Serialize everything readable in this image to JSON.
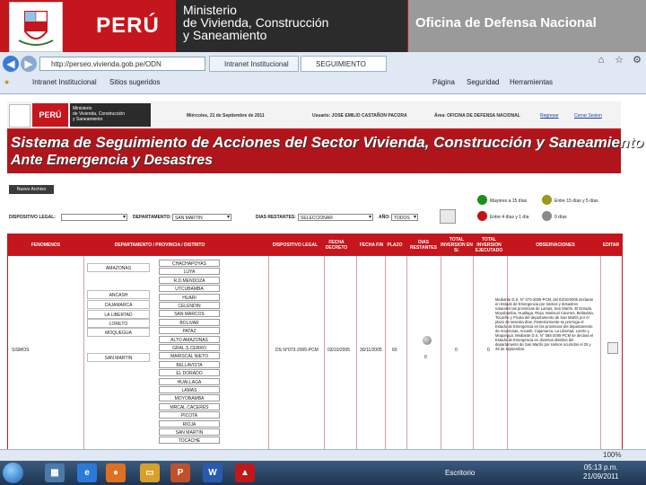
{
  "banner": {
    "country": "PERÚ",
    "ministry_lines": [
      "Ministerio",
      "de Vivienda, Construcción",
      "y Saneamiento"
    ],
    "office": "Oficina de Defensa Nacional"
  },
  "browser": {
    "address": "http://perseo.vivienda.gob.pe/ODN",
    "tabs": [
      "Intranet Institucional",
      "SEGUIMIENTO"
    ],
    "favorites": [
      "Intranet Institucional",
      "Sitios sugeridos"
    ],
    "menu": [
      "Página",
      "Seguridad",
      "Herramientas"
    ],
    "zoom": "100%"
  },
  "site": {
    "country": "PERÚ",
    "ministry_lines": [
      "Ministerio",
      "de Vivienda, Construcción",
      "y Saneamiento"
    ],
    "date": "Miércoles, 21 de Septiembre de 2011",
    "user": "Usuario: JOSE EMILIO CASTAÑON PACORA",
    "area": "Área: OFICINA DE DEFENSA NACIONAL",
    "link_back": "Regresar",
    "link_logout": "Cerrar Sesion",
    "title_line1": "Sistema de Seguimiento de Acciones del Sector Vivienda, Construcción y Saneamiento",
    "title_line2": "Ante Emergencia y Desastres",
    "new_button": "Nuevo Archivo",
    "legend": [
      {
        "label": "Mayores a 15 días",
        "color": "#1a8f1a"
      },
      {
        "label": "Entre 15 días y 5 días",
        "color": "#9a9a1a"
      },
      {
        "label": "Entre 4 días y 1 día",
        "color": "#c41111"
      },
      {
        "label": "0 días",
        "color": "#8a8a8a"
      }
    ],
    "filters": {
      "dispositivo_label": "DISPOSITIVO LEGAL:",
      "departamento_label": "DEPARTAMENTO:",
      "departamento_value": "SAN MARTIN",
      "dias_label": "DIAS RESTANTES:",
      "dias_value": "SELECCIONAR",
      "anio_label": "AÑO:",
      "anio_value": "TODOS"
    }
  },
  "table": {
    "headers": [
      "FENOMENOS",
      "DEPARTAMENTO / PROVINCIA / DISTRITO",
      "DISPOSITIVO LEGAL",
      "FECHA DECRETO",
      "FECHA FIN",
      "PLAZO",
      "DIAS RESTANTES",
      "TOTAL INVERSION EN S/.",
      "TOTAL INVERSION EJECUTADO",
      "OBSERVACIONES",
      "EDITAR"
    ],
    "fenomeno": "SISMOS",
    "dispositivo": "DS N°073-2005-PCM",
    "fecha_decreto": "03/10/2005",
    "fecha_fin": "30/11/2005",
    "plazo": "60",
    "dias_restantes": "0",
    "total_inversion": "0",
    "total_ejecutado": "0",
    "provinces": [
      {
        "name": "AMAZONAS"
      },
      {
        "name": "ANCASH"
      },
      {
        "name": "CAJAMARCA"
      },
      {
        "name": "LA LIBERTAD"
      },
      {
        "name": "LORETO"
      },
      {
        "name": "MOQUEGUA"
      },
      {
        "name": "SAN MARTIN"
      }
    ],
    "districts": [
      "CHACHAPOYAS",
      "LUYA",
      "R.D.MENDOZA",
      "UTCUBAMBA",
      "HUARI",
      "CELENDIN",
      "SAN MARCOS",
      "BOLIVAR",
      "PATAZ",
      "ALTO AMAZONAS",
      "GRAL.S.CERRO",
      "MARISCAL NIETO",
      "BELLAVISTA",
      "EL DORADO",
      "HUALLAGA",
      "LAMAS",
      "MOYOBAMBA",
      "MRCAL.CACERES",
      "PICOTA",
      "RIOJA",
      "SAN MARTIN",
      "TOCACHE"
    ],
    "observaciones": "Mediante D.S. N° 073-2005-PCM, del 03/10/2005 declaran en Estado de Emergencia por sismos y desastres naturales las provincias de Lamas, San Martín, El Dorado, Moyobamba, Huallaga, Rioja, Mariscal Cáceres, Bellavista, Tocache y Picota del departamento de San Martín por el plazo de sesenta días. Posteriormente se prorroga el Estado de Emergencia en las provincias del departamento de Amazonas, Ancash, Cajamarca, La Libertad, Loreto y Moquegua. Mediante D.S. N° 085-2005-PCM se declara el Estado de Emergencia en diversos distritos del departamento de San Martín por sismos ocurridos el 25 y 26 de septiembre."
  },
  "statusbar": {
    "zoom": "100%"
  },
  "taskbar": {
    "desktop": "Escritorio",
    "time": "05:13 p.m.",
    "date": "21/09/2011"
  }
}
